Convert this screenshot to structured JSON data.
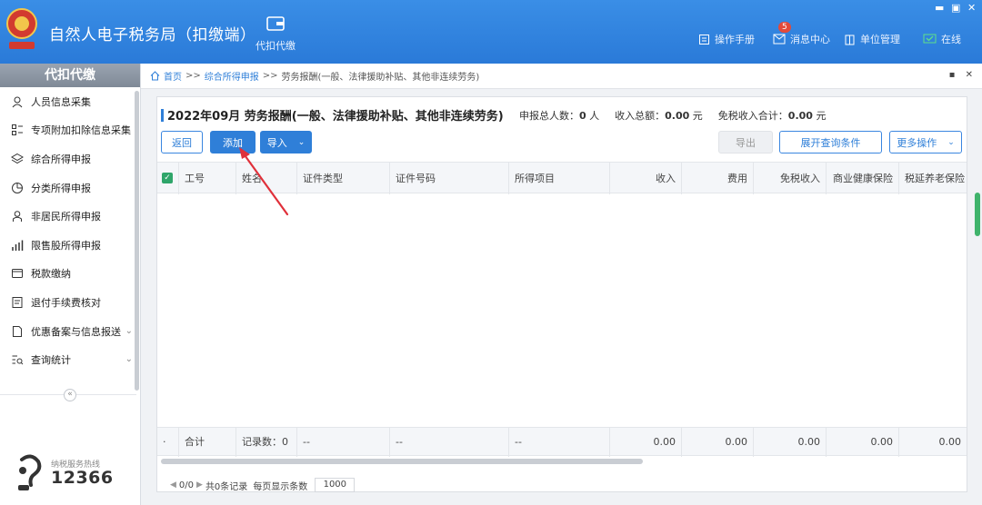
{
  "app": {
    "title": "自然人电子税务局（扣缴端）"
  },
  "top_tab": {
    "label": "代扣代缴"
  },
  "header_links": {
    "manual": "操作手册",
    "messages": "消息中心",
    "message_count": "5",
    "org": "单位管理",
    "online": "在线"
  },
  "sidebar": {
    "heading": "代扣代缴",
    "items": [
      {
        "label": "人员信息采集",
        "icon": "person-icon"
      },
      {
        "label": "专项附加扣除信息采集",
        "icon": "grid-icon"
      },
      {
        "label": "综合所得申报",
        "icon": "layers-icon"
      },
      {
        "label": "分类所得申报",
        "icon": "pie-icon"
      },
      {
        "label": "非居民所得申报",
        "icon": "person-outline-icon"
      },
      {
        "label": "限售股所得申报",
        "icon": "bar-chart-icon"
      },
      {
        "label": "税款缴纳",
        "icon": "wallet-icon"
      },
      {
        "label": "退付手续费核对",
        "icon": "document-icon"
      },
      {
        "label": "优惠备案与信息报送",
        "icon": "file-icon"
      },
      {
        "label": "查询统计",
        "icon": "list-search-icon"
      }
    ],
    "collapse_glyph": "«",
    "hotline_label": "纳税服务热线",
    "hotline_number": "12366"
  },
  "breadcrumb": {
    "home": "首页",
    "sep": ">>",
    "level1": "综合所得申报",
    "current": "劳务报酬(一般、法律援助补贴、其他非连续劳务)"
  },
  "panel": {
    "title": "2022年09月  劳务报酬(一般、法律援助补贴、其他非连续劳务)",
    "stat_people_label": "申报总人数：",
    "stat_people_value": "0",
    "stat_people_unit": "人",
    "stat_income_label": "收入总额：",
    "stat_income_value": "0.00",
    "stat_income_unit": "元",
    "stat_taxfree_label": "免税收入合计：",
    "stat_taxfree_value": "0.00",
    "stat_taxfree_unit": "元"
  },
  "toolbar": {
    "back": "返回",
    "add": "添加",
    "import": "导入",
    "export": "导出",
    "expand_query": "展开查询条件",
    "more": "更多操作"
  },
  "table": {
    "columns": [
      "工号",
      "姓名",
      "证件类型",
      "证件号码",
      "所得项目",
      "收入",
      "费用",
      "免税收入",
      "商业健康保险",
      "税延养老保险"
    ],
    "footer": {
      "label": "合计",
      "records": "记录数：0",
      "dash1": "--",
      "dash2": "--",
      "dash3": "--",
      "income": "0.00",
      "fee": "0.00",
      "taxfree": "0.00",
      "health": "0.00",
      "pension": "0.00"
    }
  },
  "pager": {
    "page": "0/0",
    "total": "共0条记录",
    "per_page_label": "每页显示条数",
    "per_page_value": "1000"
  },
  "colors": {
    "header": "#2a7ad8",
    "primary": "#2f7fd8",
    "annotation": "#e0303a"
  }
}
